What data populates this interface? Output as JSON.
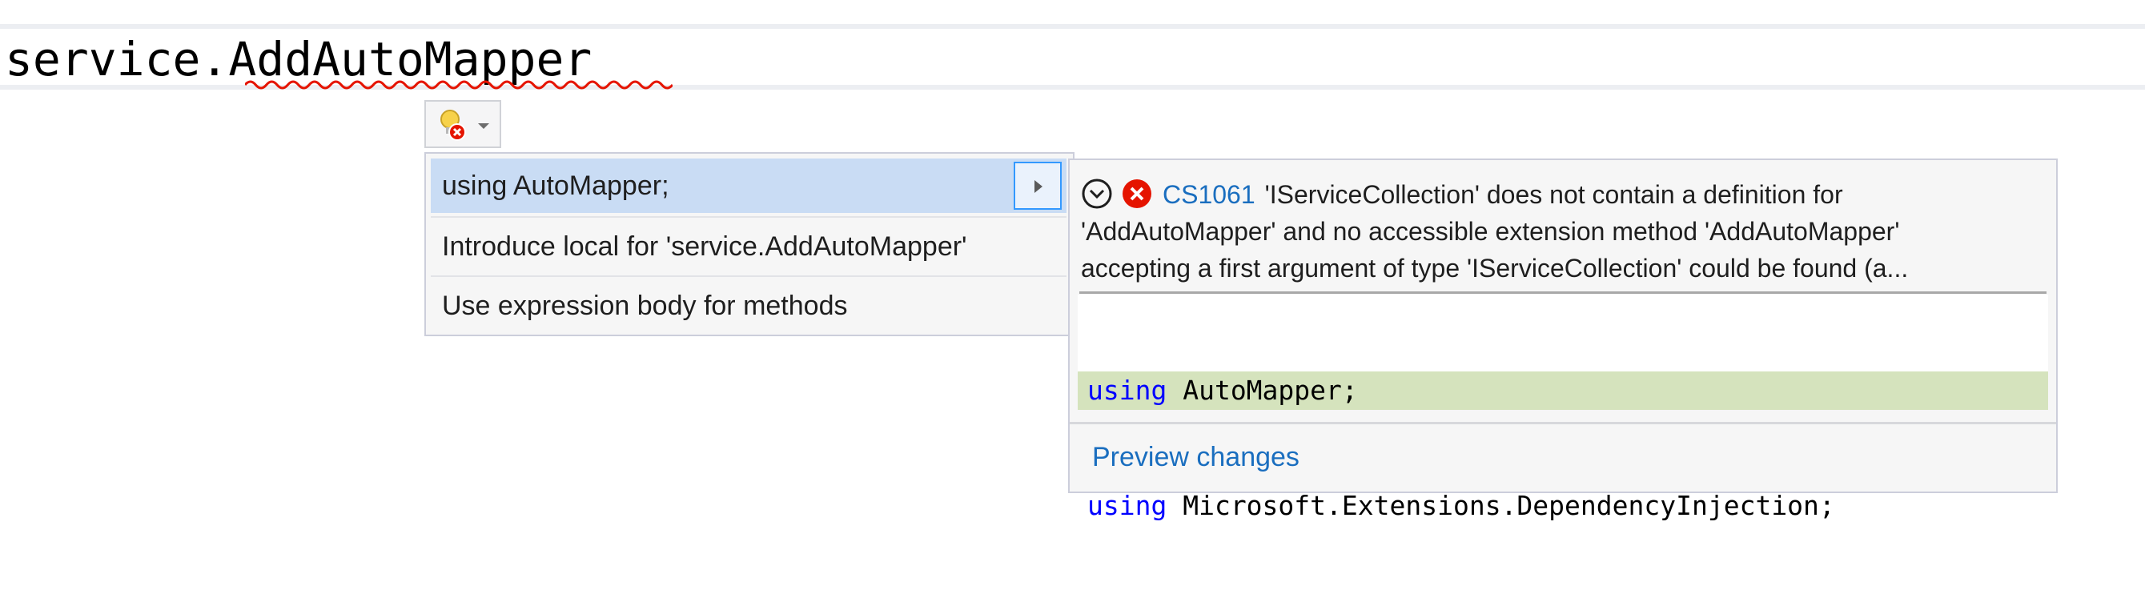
{
  "editor": {
    "code_text": "service.AddAutoMapper"
  },
  "lightbulb": {
    "icon": "lightbulb-error-icon",
    "caret_icon": "chevron-down-icon"
  },
  "quick_actions": {
    "items": [
      {
        "label": "using AutoMapper;",
        "selected": true,
        "has_submenu": true
      },
      {
        "label": "Introduce local for 'service.AddAutoMapper'",
        "selected": false
      },
      {
        "label": "Use expression body for methods",
        "selected": false
      }
    ]
  },
  "preview": {
    "diagnostic_code": "CS1061",
    "diagnostic_lines": [
      "'IServiceCollection' does not contain a definition for",
      "'AddAutoMapper' and no accessible extension method 'AddAutoMapper'",
      "accepting a first argument of type 'IServiceCollection' could be found (a..."
    ],
    "code_lines": [
      {
        "keyword": "using",
        "rest": " AutoMapper;",
        "added": true
      },
      {
        "keyword": "using",
        "rest": " Microsoft.Extensions.DependencyInjection;",
        "added": false
      }
    ],
    "link_label": "Preview changes"
  },
  "colors": {
    "squiggle": "#e51400",
    "error": "#e51400",
    "link": "#1a6ebf",
    "keyword": "#0000ff",
    "selection": "#c9dcf4",
    "added_line": "#d5e3bd"
  }
}
